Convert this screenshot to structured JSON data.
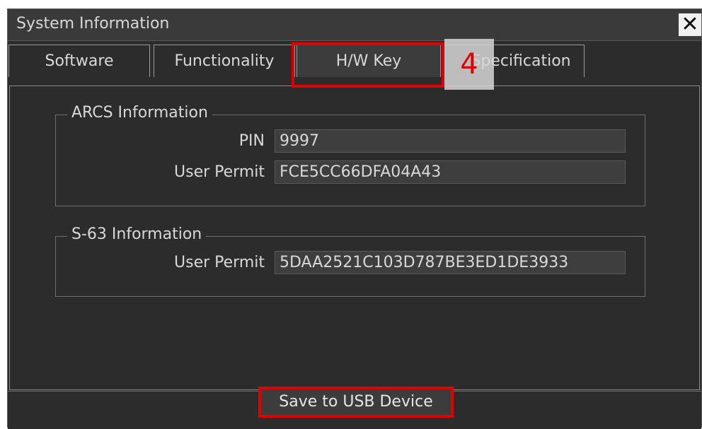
{
  "window": {
    "title": "System Information",
    "close_symbol": "✕"
  },
  "tabs": [
    {
      "label": "Software"
    },
    {
      "label": "Functionality"
    },
    {
      "label": "H/W Key"
    },
    {
      "label": "Specification"
    }
  ],
  "arcs": {
    "legend": "ARCS Information",
    "pin_label": "PIN",
    "pin_value": "9997",
    "permit_label": "User Permit",
    "permit_value": "FCE5CC66DFA04A43"
  },
  "s63": {
    "legend": "S-63 Information",
    "permit_label": "User Permit",
    "permit_value": "5DAA2521C103D787BE3ED1DE3933"
  },
  "footer": {
    "save_label": "Save to USB Device"
  },
  "annotation": {
    "step_number": "4"
  },
  "colors": {
    "highlight": "#e00000",
    "background": "#2c2c2c",
    "text": "#d8d8d8"
  }
}
